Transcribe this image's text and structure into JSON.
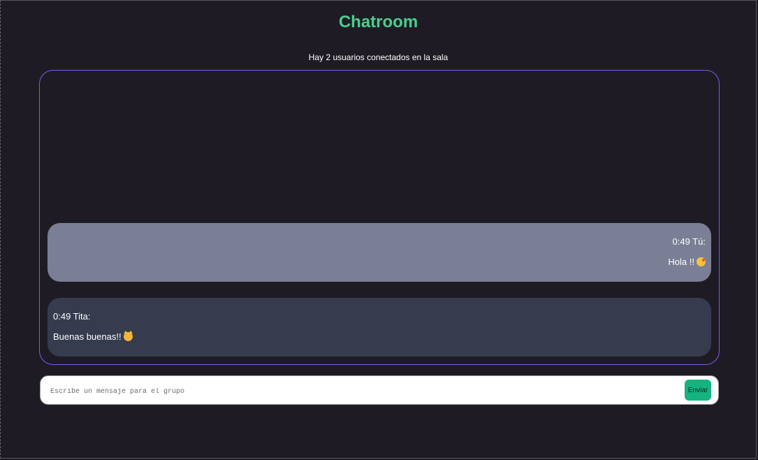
{
  "header": {
    "title": "Chatroom",
    "users_connected": "Hay 2 usuarios conectados en la sala"
  },
  "messages": [
    {
      "time": "0:49",
      "author": "Tú:",
      "header": "0:49 Tú:",
      "text": "Hola !!",
      "emoji": "kissing-face-icon",
      "own": true
    },
    {
      "time": "0:49",
      "author": "Tita:",
      "header": "0:49 Tita:",
      "text": "Buenas buenas!!",
      "emoji": "smiling-cat-icon",
      "own": false
    }
  ],
  "composer": {
    "placeholder": "Escribe un mensaje para el grupo",
    "value": "",
    "send_label": "Enviar"
  },
  "colors": {
    "background": "#1f1b24",
    "title": "#48cf8f",
    "chat_border": "#7a5cf0",
    "own_bubble": "#7b7f95",
    "other_bubble": "#363b4e",
    "send_button": "#14b37f"
  }
}
